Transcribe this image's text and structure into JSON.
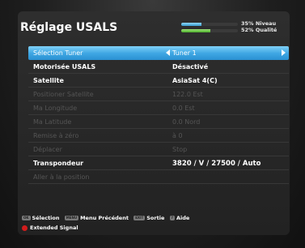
{
  "title": "Réglage USALS",
  "signal": {
    "level_percent": 35,
    "level_text": "35% Niveau",
    "quality_percent": 52,
    "quality_text": "52% Qualité",
    "level_color": "#3a9fd4",
    "quality_color": "#4caf2a"
  },
  "menu": [
    {
      "label": "Sélection Tuner",
      "value": "Tuner 1",
      "state": "selected"
    },
    {
      "label": "Motorisée USALS",
      "value": "Désactivé",
      "state": "active"
    },
    {
      "label": "Satellite",
      "value": "AsiaSat 4(C)",
      "state": "active"
    },
    {
      "label": "Positioner Satellite",
      "value": "122.0 Est",
      "state": "disabled"
    },
    {
      "label": "Ma Longitude",
      "value": "0.0 Est",
      "state": "disabled"
    },
    {
      "label": "Ma Latitude",
      "value": "0.0 Nord",
      "state": "disabled"
    },
    {
      "label": "Remise à zéro",
      "value": "à 0",
      "state": "disabled"
    },
    {
      "label": "Déplacer",
      "value": "Stop",
      "state": "disabled"
    },
    {
      "label": "Transpondeur",
      "value": "3820 / V / 27500 / Auto",
      "state": "active"
    },
    {
      "label": "Aller à la position",
      "value": "",
      "state": "disabled"
    }
  ],
  "footer": {
    "ok_key": "OK",
    "ok_label": "Sélection",
    "menu_key": "MENU",
    "menu_label": "Menu Précédent",
    "exit_key": "EXIT",
    "exit_label": "Sortie",
    "help_key": "?",
    "help_label": "Aide",
    "red_label": "Extended Signal",
    "red_color": "#d21c1c"
  },
  "colors": {
    "highlight": "#3fa7e3",
    "text_active": "#ffffff",
    "text_disabled": "#555555"
  }
}
